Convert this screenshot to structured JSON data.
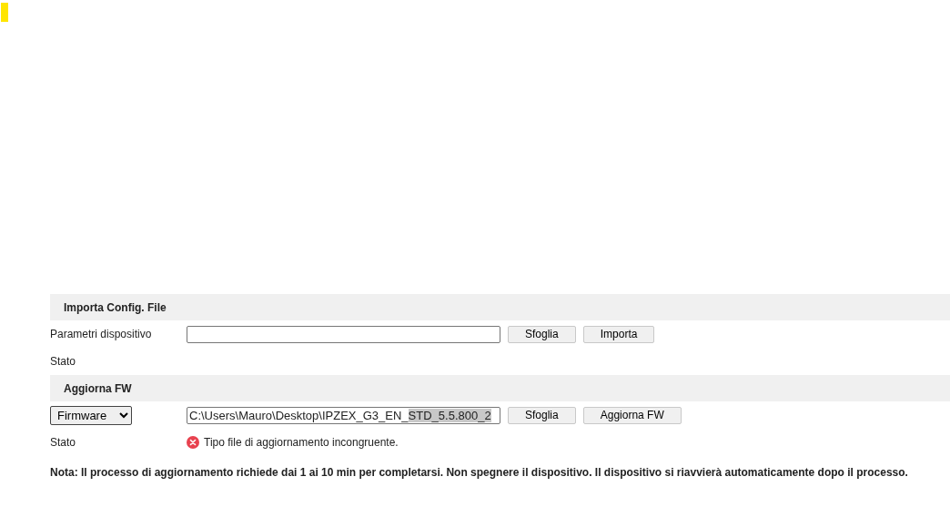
{
  "sections": [
    {
      "title": "Importa Config. File",
      "rows": [
        {
          "kind": "file",
          "label": "Parametri dispositivo",
          "value": "",
          "selected_text": "",
          "buttons": [
            "Sfoglia",
            "Importa"
          ]
        },
        {
          "kind": "status",
          "label": "Stato",
          "message": ""
        }
      ]
    },
    {
      "title": "Aggiorna FW",
      "rows": [
        {
          "kind": "file",
          "select": "Firmware",
          "value": "C:\\Users\\Mauro\\Desktop\\IPZEX_G3_EN_",
          "selected_text": "STD_5.5.800_2",
          "buttons": [
            "Sfoglia",
            "Aggiorna FW"
          ]
        },
        {
          "kind": "status",
          "label": "Stato",
          "message": "Tipo file di aggiornamento incongruente.",
          "error": true
        }
      ]
    }
  ],
  "note": "Nota: Il processo di aggiornamento richiede dai 1 ai 10 min per completarsi. Non spegnere il dispositivo. Il dispositivo si riavvierà automaticamente dopo il processo."
}
